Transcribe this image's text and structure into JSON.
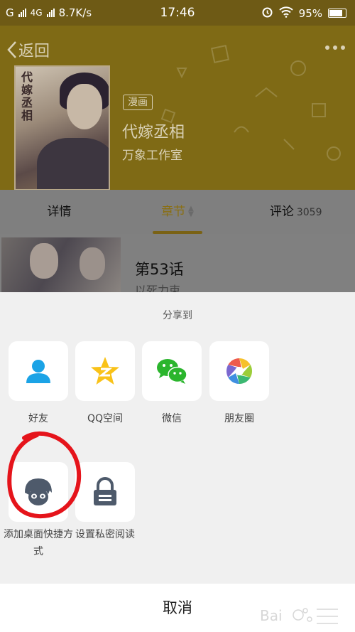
{
  "status_bar": {
    "network": "G",
    "network2": "4G",
    "speed": "8.7K/s",
    "time": "17:46",
    "battery": "95%"
  },
  "header": {
    "back_label": "返回",
    "cover_title": "代嫁丞相",
    "tag": "漫画",
    "title": "代嫁丞相",
    "author": "万象工作室"
  },
  "tabs": [
    {
      "label": "详情"
    },
    {
      "label": "章节"
    },
    {
      "label": "评论",
      "count": "3059"
    }
  ],
  "chapter": {
    "title": "第53话",
    "subtitle": "以死力束"
  },
  "share": {
    "title": "分享到",
    "items": [
      {
        "label": "好友",
        "icon": "person-icon"
      },
      {
        "label": "QQ空间",
        "icon": "qzone-star-icon"
      },
      {
        "label": "微信",
        "icon": "wechat-icon"
      },
      {
        "label": "朋友圈",
        "icon": "moments-aperture-icon"
      },
      {
        "label": "添加桌面快捷方式",
        "icon": "shortcut-avatar-icon"
      },
      {
        "label": "设置私密阅读",
        "icon": "lock-icon"
      }
    ],
    "cancel": "取消"
  },
  "colors": {
    "header_dimmed": "#7f6a15",
    "accent": "#8a6f12",
    "sheet_bg": "#f0f0f0",
    "annotation": "#e5141b"
  }
}
